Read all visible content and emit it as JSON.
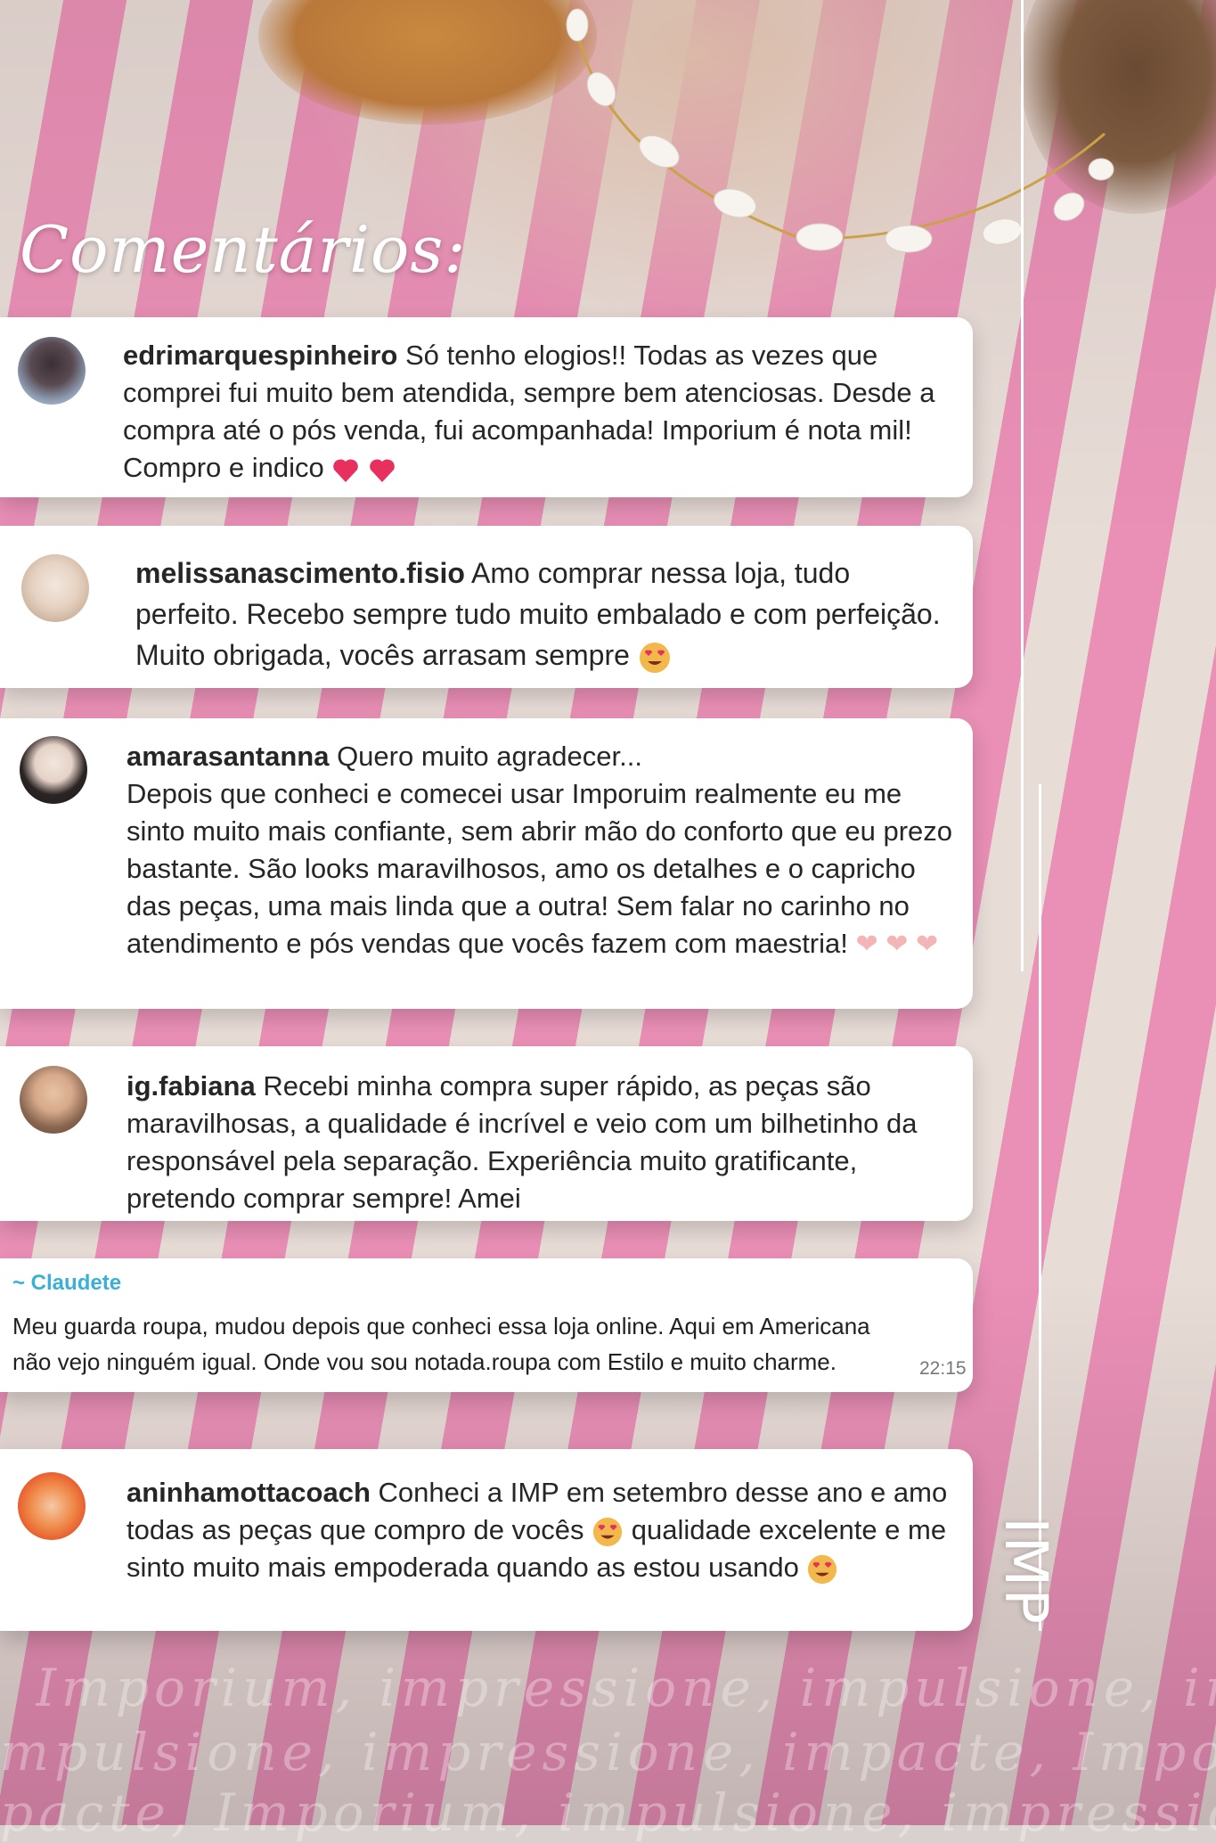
{
  "title": "Comentários:",
  "brand": "IMP",
  "comments": [
    {
      "user": "edrimarquespinheiro",
      "text": " Só tenho elogios!! Todas as vezes que comprei fui muito bem atendida, sempre bem atenciosas. Desde a compra até o pós venda, fui acompanhada! Imporium é nota mil! Compro e indico",
      "emoji": [
        "heart",
        "heart"
      ]
    },
    {
      "user": "melissanascimento.fisio",
      "text": " Amo comprar nessa loja, tudo perfeito. Recebo sempre tudo muito embalado e com perfeição. Muito obrigada, vocês arrasam sempre",
      "emoji": [
        "heart-eyes"
      ]
    },
    {
      "user": "amarasantanna",
      "text": " Quero muito agradecer...",
      "text2": "Depois que conheci e comecei usar Imporuim realmente eu me sinto muito mais confiante, sem abrir mão do conforto que eu prezo bastante. São looks maravilhosos, amo os detalhes e o capricho das peças, uma mais linda que a outra! Sem falar no carinho no atendimento e pós vendas que vocês fazem com maestria!",
      "emoji": [
        "heart-hands",
        "heart-hands",
        "heart-hands"
      ]
    },
    {
      "user": "ig.fabiana",
      "text": " Recebi minha compra super rápido, as peças são maravilhosas, a qualidade é incrível e veio com um bilhetinho da responsável pela separação. Experiência muito gratificante, pretendo comprar sempre! Amei",
      "emoji": []
    },
    {
      "user": "aninhamottacoach",
      "text": " Conheci a IMP em setembro desse ano e amo todas as peças que compro de vocês",
      "text2": "qualidade excelente e me sinto muito mais empoderada quando as estou usando",
      "emoji": [
        "heart-eyes",
        "heart-eyes"
      ]
    }
  ],
  "whatsapp": {
    "name": "~ Claudete",
    "text": "Meu guarda roupa, mudou depois que conheci essa loja online. Aqui em Americana não vejo ninguém igual. Onde vou sou notada.roupa com Estilo e muito charme.",
    "time": "22:15"
  },
  "watermark": [
    "Imporium, impressione, impulsione, impacte,",
    "mpulsione, impressione, impacte, Imporium,",
    "pacte, Imporium, impulsione, impressione, I"
  ],
  "colors": {
    "pink": "#ea8fb6",
    "linen": "#e8dcd7",
    "card": "#ffffff",
    "wa_name": "#3bb0d6"
  }
}
